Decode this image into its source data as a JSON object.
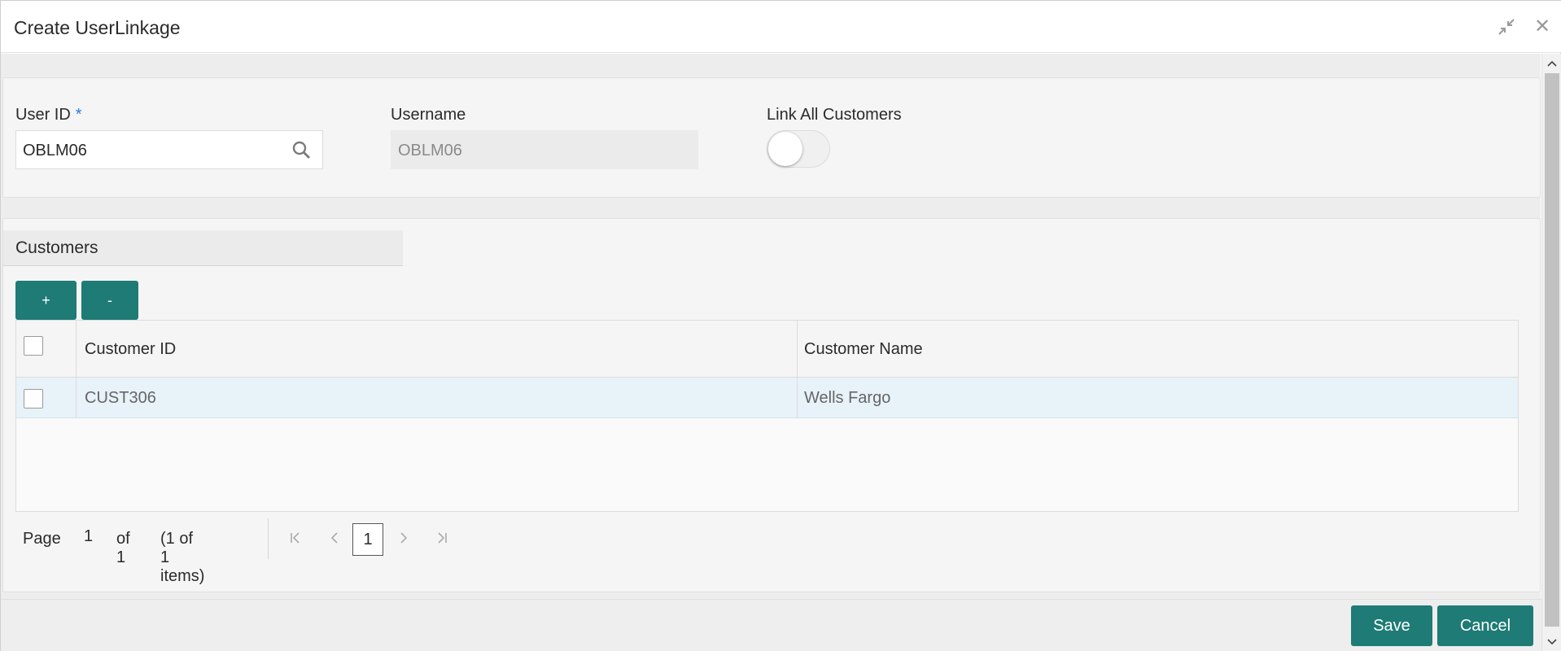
{
  "window": {
    "title": "Create UserLinkage",
    "minimize_icon": "collapse-arrows-icon",
    "close_icon": "close-icon",
    "close_glyph": "✕"
  },
  "form": {
    "user_id": {
      "label": "User ID",
      "required_mark": "*",
      "value": "OBLM06",
      "icon": "search-icon"
    },
    "username": {
      "label": "Username",
      "value": "OBLM06"
    },
    "link_all": {
      "label": "Link All Customers",
      "on": false
    }
  },
  "customers": {
    "section_title": "Customers",
    "add_label": "+",
    "remove_label": "-",
    "columns": [
      "Customer ID",
      "Customer Name"
    ],
    "rows": [
      {
        "customer_id": "CUST306",
        "customer_name": "Wells Fargo"
      }
    ]
  },
  "pagination": {
    "page_label": "Page",
    "current_page": "1",
    "of_label": "of 1",
    "items_label": "(1 of 1 items)",
    "page_box": "1"
  },
  "footer": {
    "save_label": "Save",
    "cancel_label": "Cancel"
  },
  "colors": {
    "accent": "#1e7b75",
    "required": "#2a7fd6",
    "row_highlight": "#e8f2f9"
  }
}
